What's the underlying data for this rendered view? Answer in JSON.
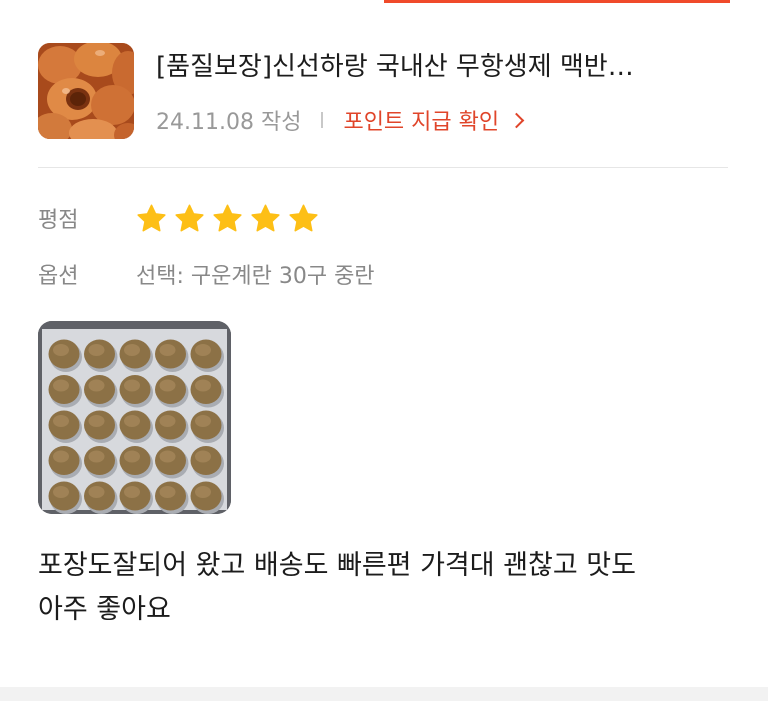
{
  "review": {
    "product": {
      "title": "[품질보장]신선하랑 국내산 무항생제 맥반…",
      "thumbnail_icon": "brown-eggs-photo"
    },
    "date": "24.11.08 작성",
    "point_link": "포인트 지급 확인",
    "rating_label": "평점",
    "rating": 5,
    "rating_max": 5,
    "option_label": "옵션",
    "option_value": "선택: 구운계란 30구 중란",
    "photo_icon": "egg-tray-photo",
    "text": "포장도잘되어 왔고 배송도 빠른편 가격대 괜찮고 맛도\n아주 좋아요"
  },
  "colors": {
    "accent": "#e0452a",
    "star": "#fdbf16",
    "muted_text": "#888888",
    "body_text": "#1c1c1c"
  }
}
